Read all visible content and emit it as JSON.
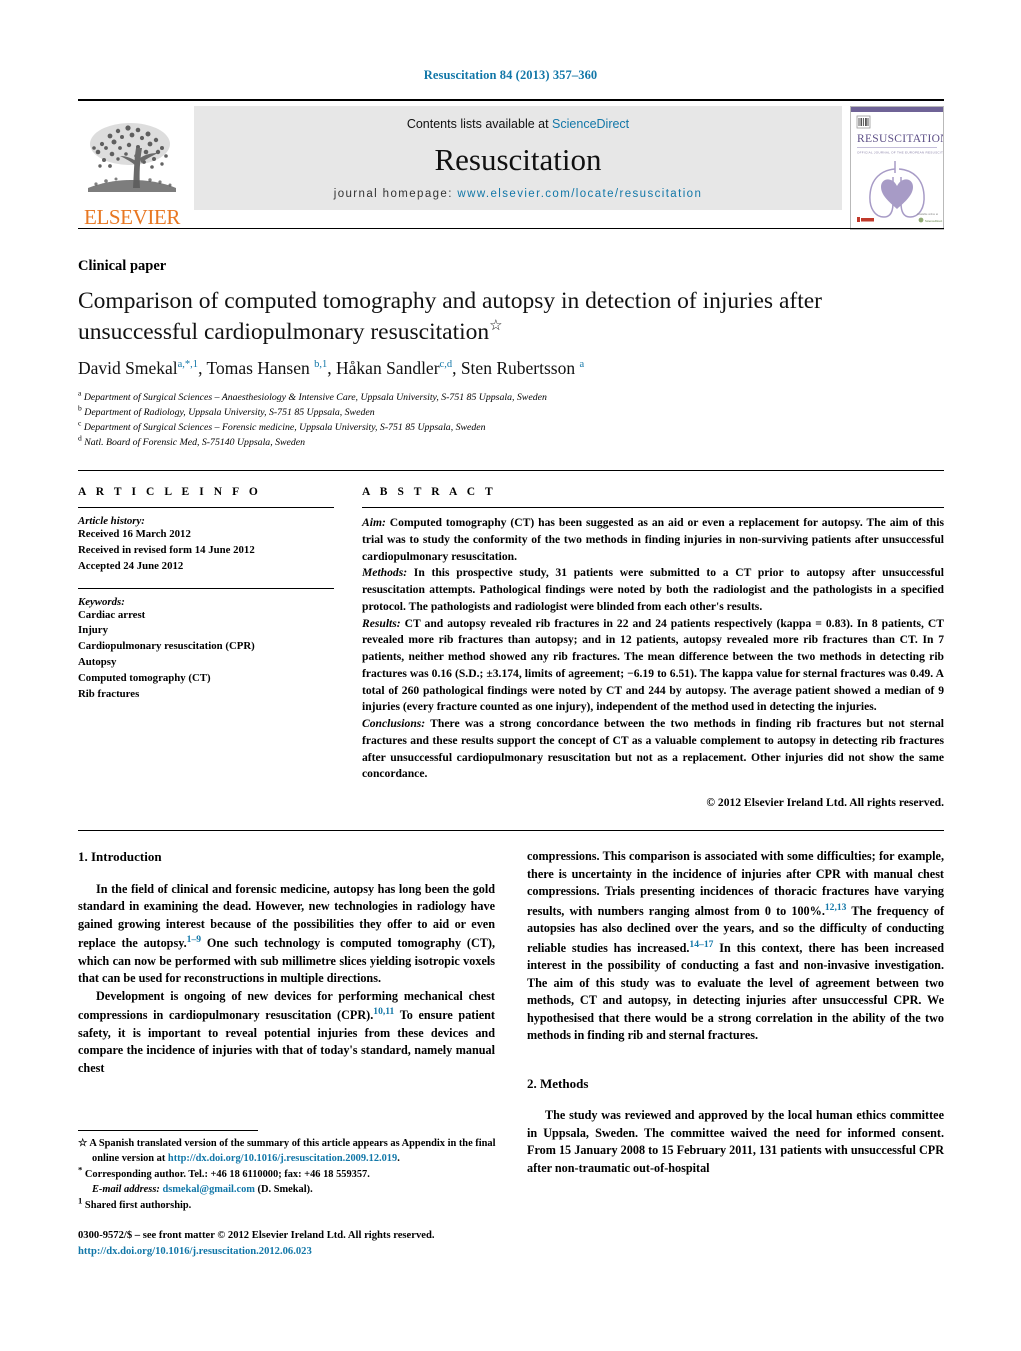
{
  "running_head": "Resuscitation 84 (2013) 357–360",
  "masthead": {
    "elsevier_wordmark": "ELSEVIER",
    "contents_prefix": "Contents lists available at ",
    "contents_link": "ScienceDirect",
    "journal_name": "Resuscitation",
    "homepage_prefix": "journal homepage: ",
    "homepage_url": "www.elsevier.com/locate/resuscitation",
    "cover_title": "RESUSCITATION",
    "cover_subtitle": "OFFICIAL JOURNAL OF THE EUROPEAN RESUSCITATION COUNCIL"
  },
  "article": {
    "paper_type": "Clinical paper",
    "title": "Comparison of computed tomography and autopsy in detection of injuries after unsuccessful cardiopulmonary resuscitation",
    "title_marker": "☆",
    "authors_html": "David Smekal<sup>a,*,1</sup>, Tomas Hansen <sup>b,1</sup>, Håkan Sandler<sup>c,d</sup>, Sten Rubertsson <sup>a</sup>",
    "affiliations": [
      "Department of Surgical Sciences – Anaesthesiology & Intensive Care, Uppsala University, S-751 85 Uppsala, Sweden",
      "Department of Radiology, Uppsala University, S-751 85 Uppsala, Sweden",
      "Department of Surgical Sciences – Forensic medicine, Uppsala University, S-751 85 Uppsala, Sweden",
      "Natl. Board of Forensic Med, S-75140 Uppsala, Sweden"
    ],
    "affiliation_marks": [
      "a",
      "b",
      "c",
      "d"
    ]
  },
  "article_info": {
    "heading": "A R T I C L E   I N F O",
    "history_label": "Article history:",
    "history": [
      "Received 16 March 2012",
      "Received in revised form 14 June 2012",
      "Accepted 24 June 2012"
    ],
    "keywords_label": "Keywords:",
    "keywords": [
      "Cardiac arrest",
      "Injury",
      "Cardiopulmonary resuscitation (CPR)",
      "Autopsy",
      "Computed tomography (CT)",
      "Rib fractures"
    ]
  },
  "abstract": {
    "heading": "A B S T R A C T",
    "aim_label": "Aim:",
    "aim_text": " Computed tomography (CT) has been suggested as an aid or even a replacement for autopsy. The aim of this trial was to study the conformity of the two methods in finding injuries in non-surviving patients after unsuccessful cardiopulmonary resuscitation.",
    "methods_label": "Methods:",
    "methods_text": " In this prospective study, 31 patients were submitted to a CT prior to autopsy after unsuccessful resuscitation attempts. Pathological findings were noted by both the radiologist and the pathologists in a specified protocol. The pathologists and radiologist were blinded from each other's results.",
    "results_label": "Results:",
    "results_text": " CT and autopsy revealed rib fractures in 22 and 24 patients respectively (kappa = 0.83). In 8 patients, CT revealed more rib fractures than autopsy; and in 12 patients, autopsy revealed more rib fractures than CT. In 7 patients, neither method showed any rib fractures. The mean difference between the two methods in detecting rib fractures was 0.16 (S.D.; ±3.174, limits of agreement; −6.19 to 6.51). The kappa value for sternal fractures was 0.49. A total of 260 pathological findings were noted by CT and 244 by autopsy. The average patient showed a median of 9 injuries (every fracture counted as one injury), independent of the method used in detecting the injuries.",
    "conclusions_label": "Conclusions:",
    "conclusions_text": " There was a strong concordance between the two methods in finding rib fractures but not sternal fractures and these results support the concept of CT as a valuable complement to autopsy in detecting rib fractures after unsuccessful cardiopulmonary resuscitation but not as a replacement. Other injuries did not show the same concordance.",
    "copyright": "© 2012 Elsevier Ireland Ltd. All rights reserved."
  },
  "body": {
    "intro_heading": "1. Introduction",
    "intro_p1_a": "In the field of clinical and forensic medicine, autopsy has long been the gold standard in examining the dead. However, new technologies in radiology have gained growing interest because of the possibilities they offer to aid or even replace the autopsy.",
    "intro_p1_ref": "1–9",
    "intro_p1_b": " One such technology is computed tomography (CT), which can now be performed with sub millimetre slices yielding isotropic voxels that can be used for reconstructions in multiple directions.",
    "intro_p2_a": "Development is ongoing of new devices for performing mechanical chest compressions in cardiopulmonary resuscitation (CPR).",
    "intro_p2_ref": "10,11",
    "intro_p2_b": " To ensure patient safety, it is important to reveal potential injuries from these devices and compare the incidence of injuries with that of today's standard, namely manual chest",
    "intro_p2_cont_a": "compressions. This comparison is associated with some difficulties; for example, there is uncertainty in the incidence of injuries after CPR with manual chest compressions. Trials presenting incidences of thoracic fractures have varying results, with numbers ranging almost from 0 to 100%.",
    "intro_p2_cont_ref1": "12,13",
    "intro_p2_cont_b": " The frequency of autopsies has also declined over the years, and so the difficulty of conducting reliable studies has increased.",
    "intro_p2_cont_ref2": "14–17",
    "intro_p2_cont_c": " In this context, there has been increased interest in the possibility of conducting a fast and non-invasive investigation. The aim of this study was to evaluate the level of agreement between two methods, CT and autopsy, in detecting injuries after unsuccessful CPR. We hypothesised that there would be a strong correlation in the ability of the two methods in finding rib and sternal fractures.",
    "methods_heading": "2. Methods",
    "methods_p1": "The study was reviewed and approved by the local human ethics committee in Uppsala, Sweden. The committee waived the need for informed consent. From 15 January 2008 to 15 February 2011, 131 patients with unsuccessful CPR after non-traumatic out-of-hospital"
  },
  "footnotes": {
    "star_marker": "☆",
    "star_text_a": " A Spanish translated version of the summary of this article appears as Appendix in the final online version at ",
    "star_link": "http://dx.doi.org/10.1016/j.resuscitation.2009.12.019",
    "star_text_b": ".",
    "corr_marker": "*",
    "corr_text": " Corresponding author. Tel.: +46 18 6110000; fax: +46 18 559357.",
    "email_label": "E-mail address:",
    "email_link": "dsmekal@gmail.com",
    "email_suffix": " (D. Smekal).",
    "shared_marker": "1",
    "shared_text": " Shared first authorship.",
    "issn_line": "0300-9572/$ – see front matter © 2012 Elsevier Ireland Ltd. All rights reserved.",
    "doi_link": "http://dx.doi.org/10.1016/j.resuscitation.2012.06.023"
  },
  "colors": {
    "link_blue": "#1277a8",
    "elsevier_orange": "#E87722",
    "band_gray": "#e7e7e7",
    "cover_purple": "#8c7fb5"
  }
}
